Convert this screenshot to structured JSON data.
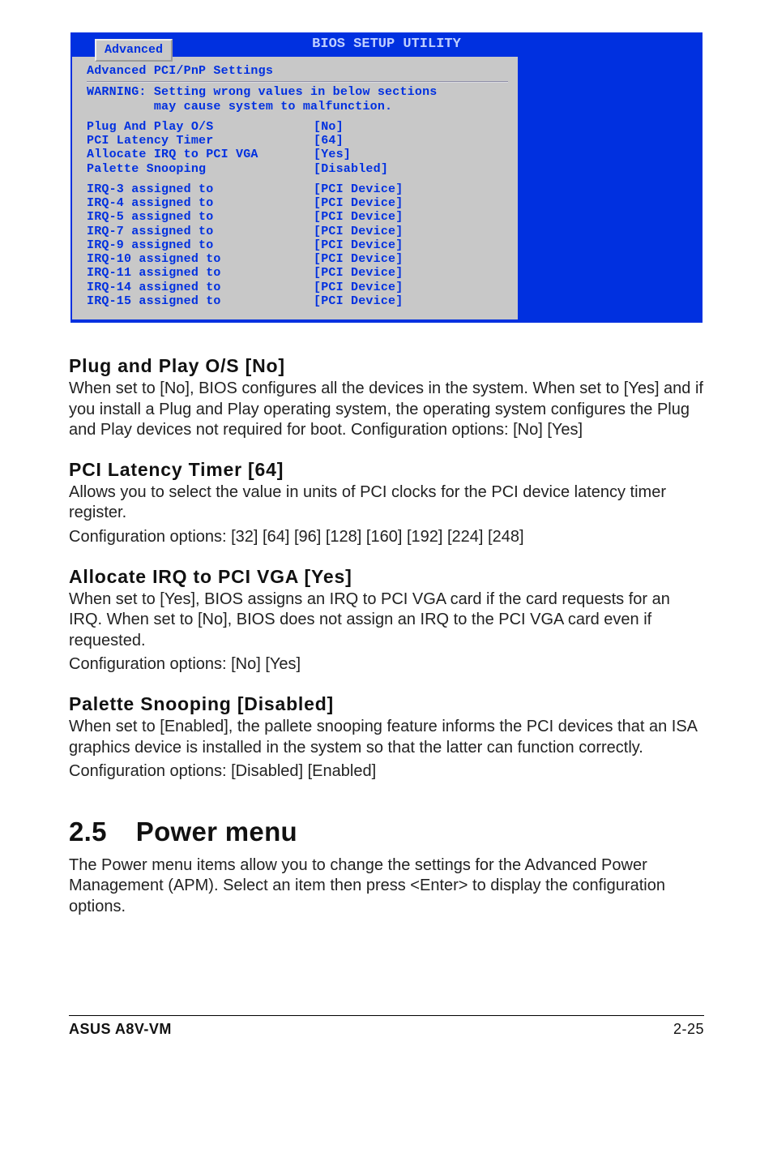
{
  "bios": {
    "utility_title": "BIOS SETUP UTILITY",
    "tab": "Advanced",
    "screen_title": "Advanced PCI/PnP Settings",
    "warning_line1": "WARNING: Setting wrong values in below sections",
    "warning_line2": "         may cause system to malfunction.",
    "settings1": [
      {
        "k": "Plug And Play O/S",
        "v": "[No]"
      },
      {
        "k": "PCI Latency Timer",
        "v": "[64]"
      },
      {
        "k": "Allocate IRQ to PCI VGA",
        "v": "[Yes]"
      },
      {
        "k": "Palette Snooping",
        "v": "[Disabled]"
      }
    ],
    "settings2": [
      {
        "k": "IRQ-3 assigned to",
        "v": "[PCI Device]"
      },
      {
        "k": "IRQ-4 assigned to",
        "v": "[PCI Device]"
      },
      {
        "k": "IRQ-5 assigned to",
        "v": "[PCI Device]"
      },
      {
        "k": "IRQ-7 assigned to",
        "v": "[PCI Device]"
      },
      {
        "k": "IRQ-9 assigned to",
        "v": "[PCI Device]"
      },
      {
        "k": "IRQ-10 assigned to",
        "v": "[PCI Device]"
      },
      {
        "k": "IRQ-11 assigned to",
        "v": "[PCI Device]"
      },
      {
        "k": "IRQ-14 assigned to",
        "v": "[PCI Device]"
      },
      {
        "k": "IRQ-15 assigned to",
        "v": "[PCI Device]"
      }
    ]
  },
  "opts": {
    "plug_play": {
      "title": "Plug and Play O/S [No]",
      "desc": "When set to [No], BIOS configures all the devices in the system. When set to [Yes] and if you install a Plug and Play operating system, the operating system configures the Plug and Play devices not required for boot. Configuration options: [No] [Yes]"
    },
    "pci_latency": {
      "title": "PCI Latency Timer [64]",
      "desc1": "Allows you to select the value in units of PCI clocks for the PCI device latency timer register.",
      "desc2": "Configuration options: [32] [64] [96] [128] [160] [192] [224] [248]"
    },
    "allocate_irq": {
      "title": "Allocate IRQ to PCI VGA [Yes]",
      "desc": "When set to [Yes], BIOS assigns an IRQ to PCI VGA card if the card requests for an IRQ. When set to [No], BIOS does not assign an IRQ to the PCI VGA card even if requested.",
      "desc2": "Configuration options: [No] [Yes]"
    },
    "palette": {
      "title": "Palette Snooping [Disabled]",
      "desc": "When set to [Enabled], the pallete snooping feature informs the PCI devices that an ISA graphics device is installed in the system so that the latter can function correctly.",
      "desc2": "Configuration options: [Disabled] [Enabled]"
    }
  },
  "power_menu": {
    "num": "2.5",
    "title": "Power menu",
    "desc": "The Power menu items allow you to change the settings for the Advanced Power Management (APM). Select an item then press <Enter> to display the configuration options."
  },
  "footer": {
    "left": "ASUS A8V-VM",
    "right": "2-25"
  }
}
